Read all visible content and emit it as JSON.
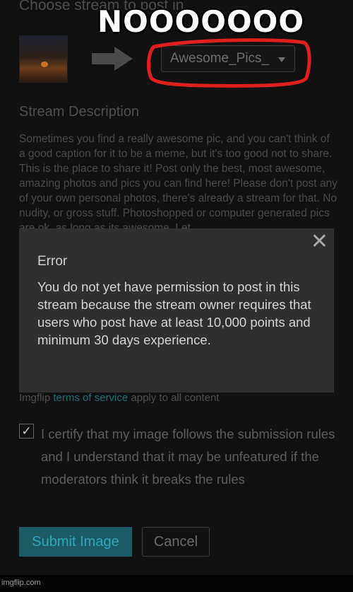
{
  "heading": "Choose stream to post in",
  "meme_caption": "NOOOOOOO",
  "stream_select": {
    "value": "Awesome_Pics_",
    "caret": "chevron-down-icon"
  },
  "description": {
    "label": "Stream Description",
    "text": "Sometimes you find a really awesome pic, and you can't think of a good caption for it to be a meme, but it's too good not to share. This is the place to share it! Post only the best, most awesome, amazing photos and pics you can find here! Please don't post any of your own personal photos, there's already a stream for that. No nudity, or gross stuff. Photoshopped or computer generated pics are ok, as long as its awesome. Let"
  },
  "error_dialog": {
    "title": "Error",
    "message": "You do not yet have permission to post in this stream because the stream owner requires that users who post have at least 10,000 points and minimum 30 days experience.",
    "close_glyph": "✕"
  },
  "tos": {
    "prefix": "Imgflip ",
    "link": "terms of service",
    "suffix": " apply to all content"
  },
  "certify": {
    "checked": true,
    "check_glyph": "✓",
    "label": "I certify that my image follows the submission rules and I understand that it may be unfeatured if the moderators think it breaks the rules"
  },
  "buttons": {
    "submit": "Submit Image",
    "cancel": "Cancel"
  },
  "watermark": "imgflip.com",
  "colors": {
    "accent": "#1c5a66",
    "annotation_red": "#e0201e"
  }
}
